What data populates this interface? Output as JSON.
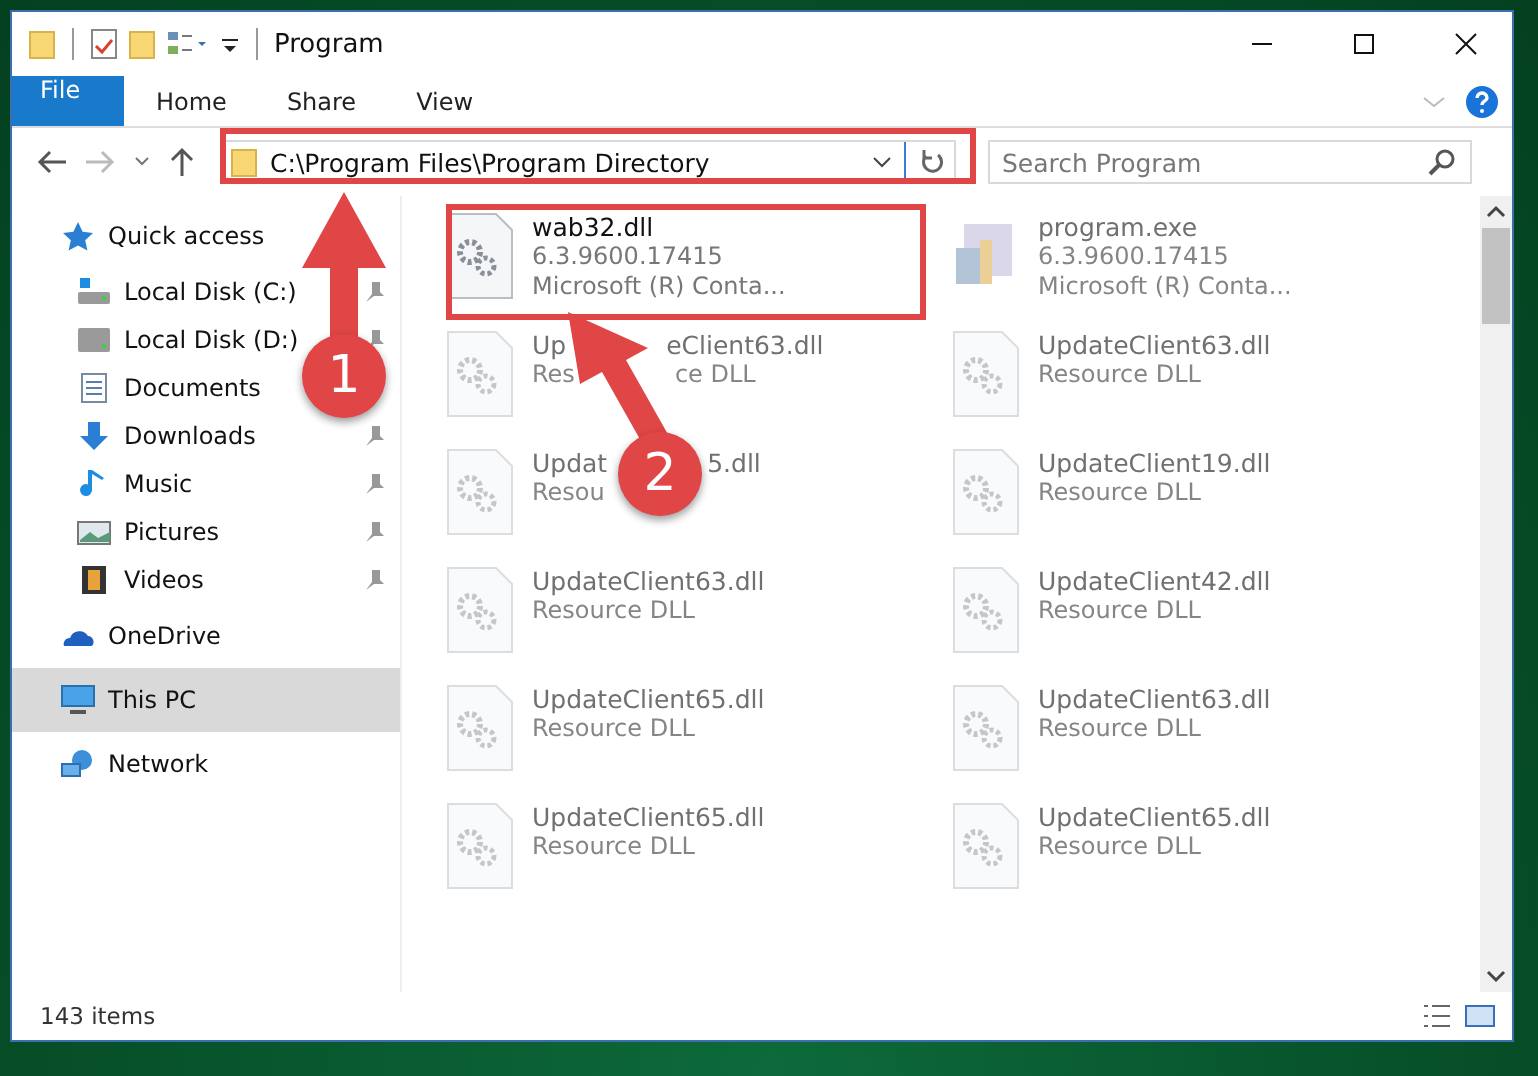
{
  "window": {
    "title": "Program"
  },
  "ribbon_tabs": [
    {
      "label": "File",
      "kind": "file"
    },
    {
      "label": "Home",
      "kind": "tab"
    },
    {
      "label": "Share",
      "kind": "tab"
    },
    {
      "label": "View",
      "kind": "tab"
    }
  ],
  "address": {
    "path": "C:\\Program Files\\Program Directory"
  },
  "search": {
    "placeholder": "Search Program"
  },
  "sidebar": {
    "items": [
      {
        "label": "Quick access",
        "kind": "star",
        "selected": false,
        "children": [
          {
            "label": "Local Disk (C:)",
            "kind": "system-drive",
            "pinned": true
          },
          {
            "label": "Local Disk (D:)",
            "kind": "drive",
            "pinned": true
          },
          {
            "label": "Documents",
            "kind": "document",
            "pinned": false
          },
          {
            "label": "Downloads",
            "kind": "download",
            "pinned": true
          },
          {
            "label": "Music",
            "kind": "music",
            "pinned": true
          },
          {
            "label": "Pictures",
            "kind": "pictures",
            "pinned": true
          },
          {
            "label": "Videos",
            "kind": "film",
            "pinned": true
          }
        ]
      },
      {
        "label": "OneDrive",
        "kind": "cloud",
        "selected": false
      },
      {
        "label": "This PC",
        "kind": "monitor",
        "selected": true
      },
      {
        "label": "Network",
        "kind": "network",
        "selected": false
      }
    ]
  },
  "files": [
    {
      "name": "wab32.dll",
      "line_2": "6.3.9600.17415",
      "line_3": "Microsoft (R) Conta...",
      "kind": "dll",
      "faded": false
    },
    {
      "name": "program.exe",
      "line_2": "6.3.9600.17415",
      "line_3": "Microsoft (R) Conta...",
      "kind": "exe",
      "faded": true
    },
    {
      "name": "Up",
      "name_rest": "eClient63.dll",
      "line_2": "Res",
      "line_2_rest": "ce DLL",
      "kind": "dll",
      "faded": true
    },
    {
      "name": "UpdateClient63.dll",
      "line_2": "Resource DLL",
      "kind": "dll",
      "faded": true
    },
    {
      "name": "Updat",
      "name_rest": "5.dll",
      "line_2": "Resou",
      "kind": "dll",
      "faded": true
    },
    {
      "name": "UpdateClient19.dll",
      "line_2": "Resource DLL",
      "kind": "dll",
      "faded": true
    },
    {
      "name": "UpdateClient63.dll",
      "line_2": "Resource DLL",
      "kind": "dll",
      "faded": true
    },
    {
      "name": "UpdateClient42.dll",
      "line_2": "Resource DLL",
      "kind": "dll",
      "faded": true
    },
    {
      "name": "UpdateClient65.dll",
      "line_2": "Resource DLL",
      "kind": "dll",
      "faded": true
    },
    {
      "name": "UpdateClient63.dll",
      "line_2": "Resource DLL",
      "kind": "dll",
      "faded": true
    },
    {
      "name": "UpdateClient65.dll",
      "line_2": "Resource DLL",
      "kind": "dll",
      "faded": true
    },
    {
      "name": "UpdateClient65.dll",
      "line_2": "Resource DLL",
      "kind": "dll",
      "faded": true
    }
  ],
  "status_bar": {
    "item_count": "143 items"
  },
  "annotations": [
    {
      "number": "1"
    },
    {
      "number": "2"
    }
  ]
}
